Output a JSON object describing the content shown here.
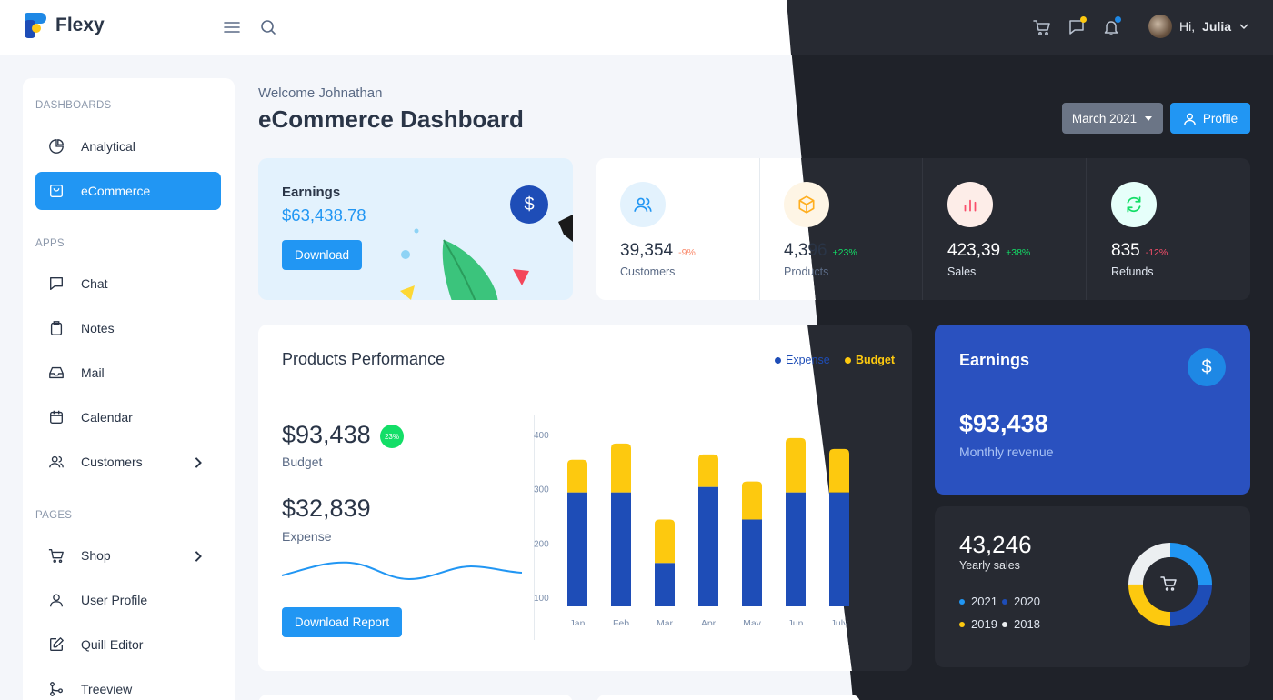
{
  "app": {
    "name": "Flexy"
  },
  "topbar": {
    "user_greeting": "Hi,",
    "user_name": "Julia"
  },
  "sidebar": {
    "sections": [
      {
        "label": "DASHBOARDS"
      },
      {
        "label": "APPS"
      },
      {
        "label": "PAGES"
      }
    ],
    "items": [
      {
        "label": "Analytical"
      },
      {
        "label": "eCommerce"
      },
      {
        "label": "Chat"
      },
      {
        "label": "Notes"
      },
      {
        "label": "Mail"
      },
      {
        "label": "Calendar"
      },
      {
        "label": "Customers"
      },
      {
        "label": "Shop"
      },
      {
        "label": "User Profile"
      },
      {
        "label": "Quill Editor"
      },
      {
        "label": "Treeview"
      }
    ]
  },
  "header": {
    "welcome": "Welcome Johnathan",
    "title": "eCommerce Dashboard",
    "month_select": "March 2021",
    "profile_button": "Profile"
  },
  "earnings_card": {
    "label": "Earnings",
    "value": "$63,438.78",
    "button": "Download"
  },
  "stats": [
    {
      "value": "39,354",
      "change": "-9%",
      "label": "Customers"
    },
    {
      "value": "4,396",
      "change": "+23%",
      "label": "Products"
    },
    {
      "value": "423,39",
      "change": "+38%",
      "label": "Sales"
    },
    {
      "value": "835",
      "change": "-12%",
      "label": "Refunds"
    }
  ],
  "performance": {
    "title": "Products Performance",
    "legend_expense": "Expense",
    "legend_budget": "Budget",
    "budget_value": "$93,438",
    "budget_badge": "23%",
    "budget_label": "Budget",
    "expense_value": "$32,839",
    "expense_label": "Expense",
    "button": "Download Report"
  },
  "chart_data": {
    "type": "bar",
    "stacked": true,
    "categories": [
      "Jan",
      "Feb",
      "Mar",
      "Apr",
      "May",
      "Jun",
      "July"
    ],
    "y_ticks": [
      "400",
      "300",
      "200",
      "100"
    ],
    "ylim": [
      85,
      420
    ],
    "series": [
      {
        "name": "Expense",
        "color": "#1e4db7",
        "values": [
          295,
          295,
          165,
          305,
          245,
          295,
          295
        ]
      },
      {
        "name": "Budget",
        "color": "#fdc90f",
        "values": [
          60,
          90,
          80,
          60,
          70,
          100,
          80
        ]
      }
    ]
  },
  "earnings_blue": {
    "label": "Earnings",
    "value": "$93,438",
    "sub": "Monthly revenue"
  },
  "yearly_sales": {
    "value": "43,246",
    "label": "Yearly sales",
    "legend": [
      {
        "label": "2021",
        "color": "#2196f3"
      },
      {
        "label": "2020",
        "color": "#1e4db7"
      },
      {
        "label": "2019",
        "color": "#fdc90f"
      },
      {
        "label": "2018",
        "color": "#eceff1"
      }
    ]
  },
  "colors": {
    "primary": "#2196f3",
    "secondary": "#1e4db7",
    "warning": "#fdc90f",
    "dark_bg": "#1f2229",
    "dark_card": "#272a32"
  }
}
